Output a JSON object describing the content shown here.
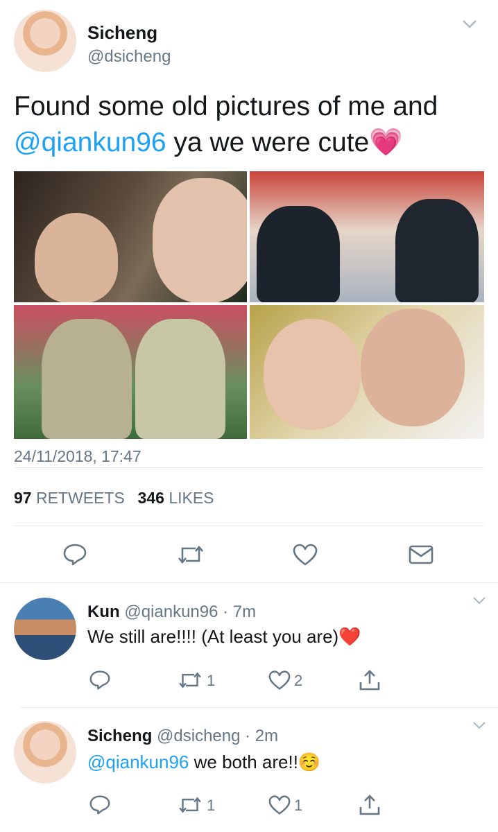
{
  "tweet": {
    "author_name": "Sicheng",
    "author_handle": "@dsicheng",
    "text_part1": "Found some old pictures of me and",
    "mention": "@qiankun96",
    "text_part2": " ya we were cute💗",
    "timestamp": "24/11/2018, 17:47",
    "retweets_count": "97",
    "retweets_label": "RETWEETS",
    "likes_count": "346",
    "likes_label": "LIKES",
    "photo_count": 4
  },
  "replies": [
    {
      "author_name": "Kun",
      "author_handle": "@qiankun96",
      "time": "· 7m",
      "text": "We still are!!!! (At least you are)❤️",
      "retweets": "1",
      "likes": "2"
    },
    {
      "author_name": "Sicheng",
      "author_handle": "@dsicheng",
      "time": "· 2m",
      "mention": "@qiankun96",
      "text": " we both are!!☺️",
      "retweets": "1",
      "likes": "1"
    }
  ],
  "icons": [
    "chevron-down-icon",
    "reply-icon",
    "retweet-icon",
    "like-icon",
    "message-icon",
    "share-icon"
  ],
  "colors": {
    "link": "#1da1f2",
    "muted": "#657786",
    "divider": "#e6ecf0",
    "icon": "#657786"
  }
}
